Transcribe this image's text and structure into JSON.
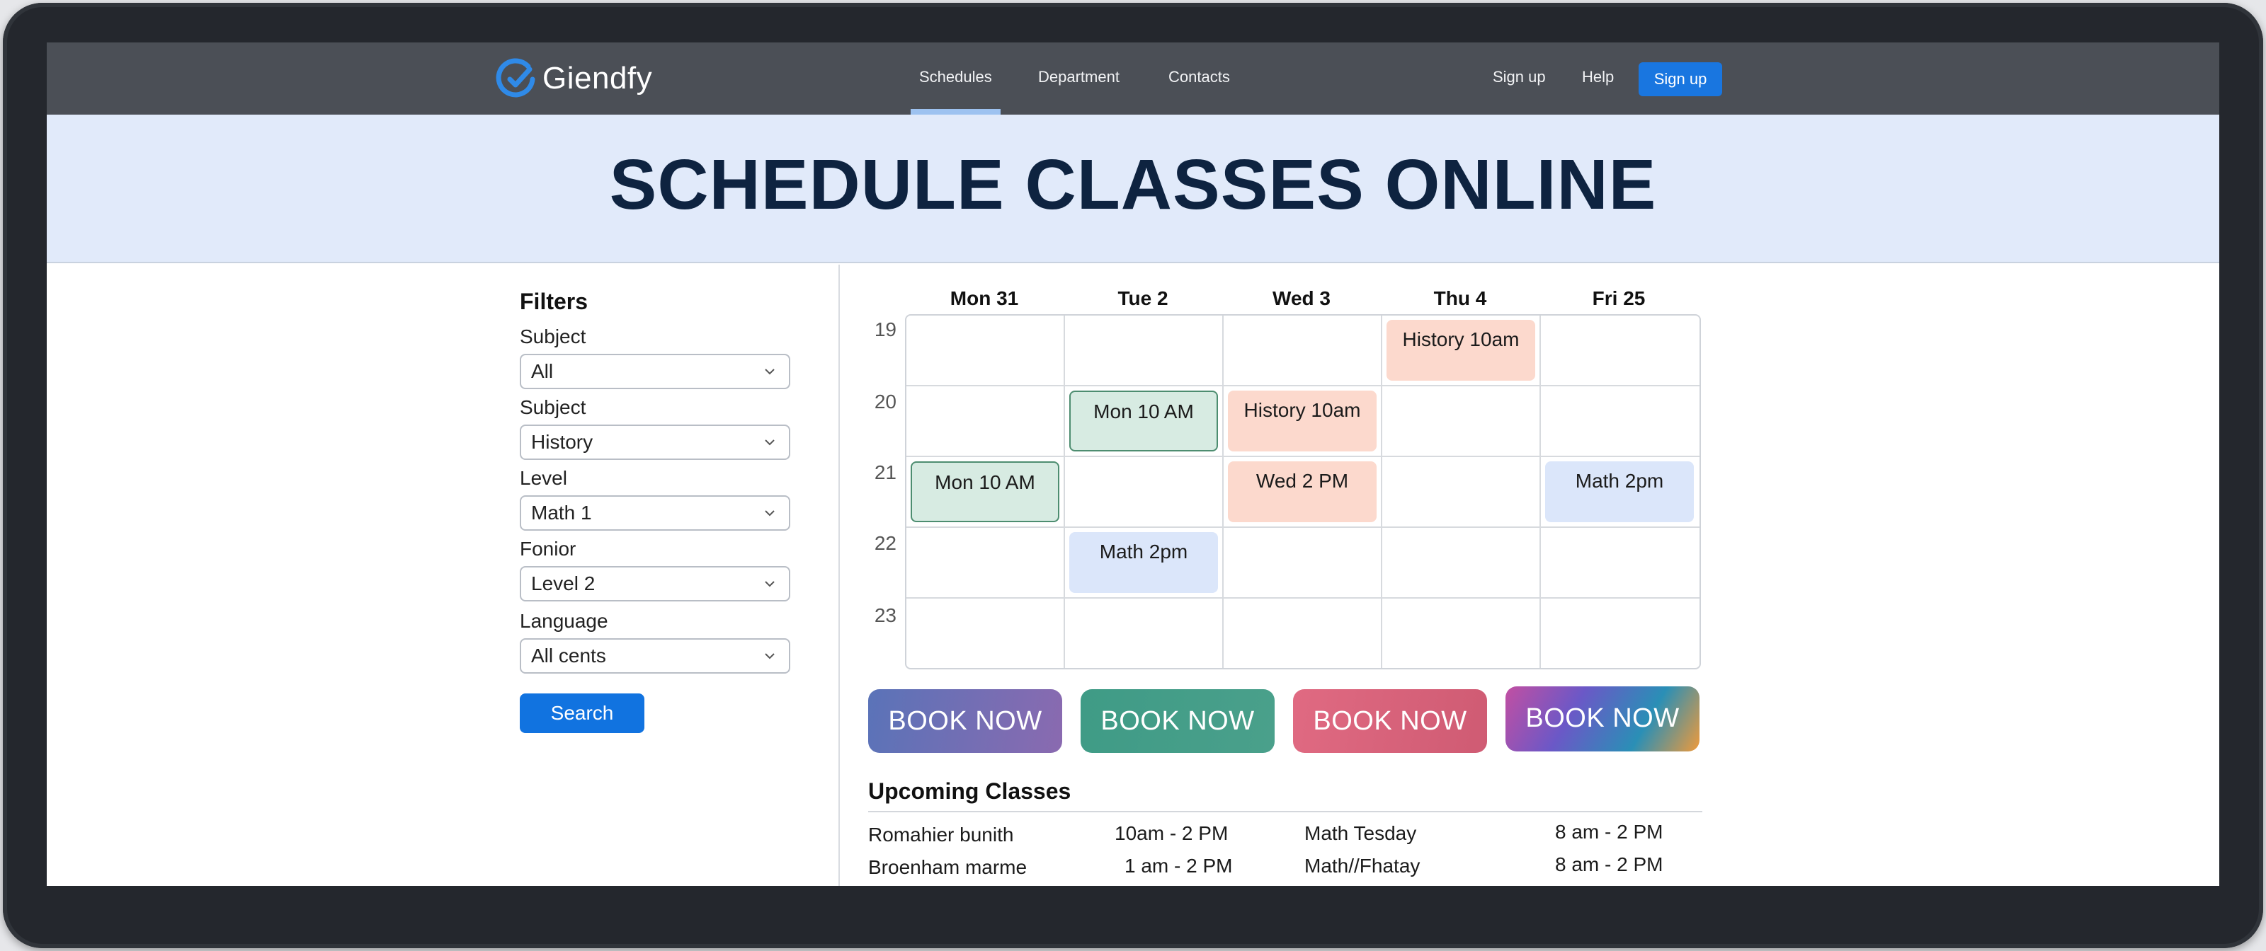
{
  "nav": {
    "brand": "Giendfy",
    "links": [
      "Schedules",
      "Department",
      "Contacts"
    ],
    "active": "Schedules",
    "right_links": [
      "Sign up",
      "Help"
    ],
    "cta": "Sign up",
    "colors": {
      "bar": "#4b4f56",
      "cta": "#1976e0",
      "brand_mark": "#2f8ae8"
    }
  },
  "hero": {
    "title": "SCHEDULE CLASSES ONLINE"
  },
  "filters": {
    "title": "Filters",
    "fields": [
      {
        "label": "Subject",
        "value": "All"
      },
      {
        "label": "Subject",
        "value": "History"
      },
      {
        "label": "Level",
        "value": "Math 1"
      },
      {
        "label": "Fonior",
        "value": "Level 2"
      },
      {
        "label": "Language",
        "value": "All cents"
      }
    ],
    "search": "Search"
  },
  "calendar": {
    "days": [
      "Mon 31",
      "Tue 2",
      "Wed 3",
      "Thu 4",
      "Fri 25"
    ],
    "hours": [
      "19",
      "20",
      "21",
      "22",
      "23"
    ],
    "events": [
      {
        "label": "History 10am",
        "day": 3,
        "hour": 0,
        "style": "peach"
      },
      {
        "label": "Mon 10 AM",
        "day": 1,
        "hour": 1,
        "style": "green"
      },
      {
        "label": "History 10am",
        "day": 2,
        "hour": 1,
        "style": "peach"
      },
      {
        "label": "Mon 10 AM",
        "day": 0,
        "hour": 2,
        "style": "green"
      },
      {
        "label": "Wed 2 PM",
        "day": 2,
        "hour": 2,
        "style": "peach"
      },
      {
        "label": "Math 2pm",
        "day": 4,
        "hour": 2,
        "style": "blue"
      },
      {
        "label": "Math 2pm",
        "day": 1,
        "hour": 3,
        "style": "blue"
      }
    ]
  },
  "book_buttons": [
    "BOOK NOW",
    "BOOK NOW",
    "BOOK NOW",
    "BOOK NOW"
  ],
  "upcoming": {
    "title": "Upcoming Classes",
    "rows": [
      [
        "Romahier bunith",
        "10am - 2 PM",
        "Math Tesday",
        "8 am - 2 PM"
      ],
      [
        "Broenham marme",
        "1 am - 2 PM",
        "Math//Fhatay",
        "8 am - 2 PM"
      ]
    ]
  }
}
